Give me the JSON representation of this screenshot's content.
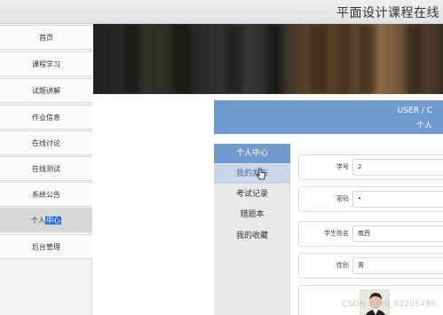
{
  "header": {
    "site_title": "平面设计课程在线"
  },
  "sidebar": {
    "items": [
      {
        "label": "首页"
      },
      {
        "label": "课程学习"
      },
      {
        "label": "试题讲解"
      },
      {
        "label": "作业信息"
      },
      {
        "label": "在线讨论"
      },
      {
        "label": "在线测试"
      },
      {
        "label": "系统公告"
      },
      {
        "label_prefix": "个人",
        "label_highlight": "中心"
      },
      {
        "label": "后台管理"
      }
    ]
  },
  "userbar": {
    "title_en": "USER / C",
    "title_cn": "个人"
  },
  "pcmenu": {
    "header": "个人中心",
    "items": [
      {
        "label": "我的发布"
      },
      {
        "label": "考试记录"
      },
      {
        "label": "错题本"
      },
      {
        "label": "我的收藏"
      }
    ]
  },
  "form": {
    "fields": [
      {
        "label": "学号",
        "value": "2"
      },
      {
        "label": "密码",
        "value": "•"
      },
      {
        "label": "学生姓名",
        "value": "南西"
      },
      {
        "label": "性别",
        "value": "男"
      }
    ]
  },
  "watermark": "CSDN @m0_62205496",
  "colors": {
    "accent": "#6f9bd1",
    "nav_active": "#d7d7d7",
    "highlight": "#2f6fd4"
  },
  "icons": {
    "cursor": "hand-pointer-icon",
    "avatar": "student-photo"
  }
}
